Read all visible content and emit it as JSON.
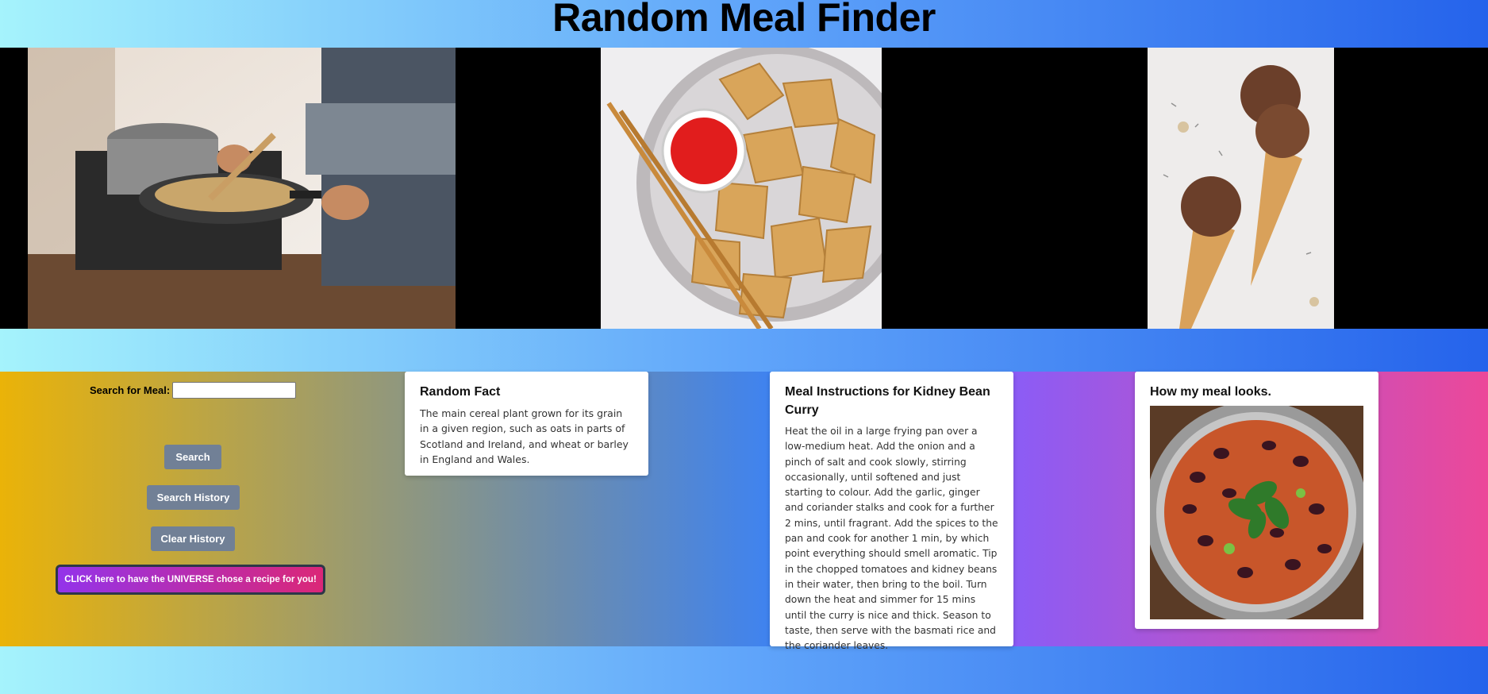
{
  "page": {
    "title": "Random Meal Finder"
  },
  "banner": {
    "images": [
      {
        "name": "cooking-photo",
        "alt": "cooking-at-stove"
      },
      {
        "name": "wontons-photo",
        "alt": "fried-wontons-bowl"
      },
      {
        "name": "icecream-photo",
        "alt": "chocolate-ice-cream-cones"
      }
    ]
  },
  "search": {
    "label": "Search for Meal:",
    "input_value": "",
    "search_button": "Search",
    "history_button": "Search History",
    "clear_button": "Clear History",
    "universe_button": "CLICK here to have the UNIVERSE chose a recipe for you!"
  },
  "fact_card": {
    "title": "Random Fact",
    "text": "The main cereal plant grown for its grain in a given region, such as oats in parts of Scotland and Ireland, and wheat or barley in England and Wales."
  },
  "instructions_card": {
    "title": "Meal Instructions for Kidney Bean Curry",
    "text": "Heat the oil in a large frying pan over a low-medium heat. Add the onion and a pinch of salt and cook slowly, stirring occasionally, until softened and just starting to colour. Add the garlic, ginger and coriander stalks and cook for a further 2 mins, until fragrant. Add the spices to the pan and cook for another 1 min, by which point everything should smell aromatic. Tip in the chopped tomatoes and kidney beans in their water, then bring to the boil. Turn down the heat and simmer for 15 mins until the curry is nice and thick. Season to taste, then serve with the basmati rice and the coriander leaves."
  },
  "looks_card": {
    "title": "How my meal looks."
  },
  "colors": {
    "button_gray": "#718096",
    "universe_gradient_start": "#9333ea",
    "universe_gradient_end": "#db2777"
  }
}
